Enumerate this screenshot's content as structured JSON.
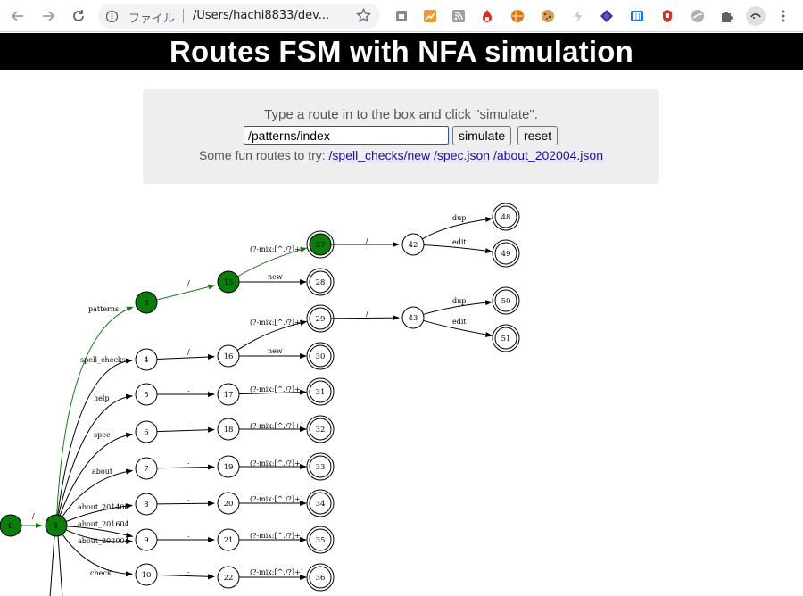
{
  "browser": {
    "omnibox_label": "ファイル",
    "url": "/Users/hachi8833/dev..."
  },
  "page": {
    "title": "Routes FSM with NFA simulation",
    "instructions": "Type a route in to the box and click \"simulate\".",
    "route_input_value": "/patterns/index",
    "simulate_label": "simulate",
    "reset_label": "reset",
    "fun_label": "Some fun routes to try:",
    "fun_routes": [
      "/spell_checks/new",
      "/spec.json",
      "/about_202004.json"
    ]
  },
  "colors": {
    "active_node": "#0a7d0a",
    "active_edge": "#1a7a1a",
    "banner": "#000000",
    "link": "#1a0dab"
  },
  "graph": {
    "nodes": [
      {
        "id": "0",
        "final": false,
        "active": true
      },
      {
        "id": "1",
        "final": false,
        "active": true
      },
      {
        "id": "3",
        "final": false,
        "active": true
      },
      {
        "id": "15",
        "final": false,
        "active": true
      },
      {
        "id": "27",
        "final": true,
        "active": true
      },
      {
        "id": "28",
        "final": true,
        "active": false
      },
      {
        "id": "42",
        "final": false,
        "active": false
      },
      {
        "id": "48",
        "final": true,
        "active": false
      },
      {
        "id": "49",
        "final": true,
        "active": false
      },
      {
        "id": "4",
        "final": false,
        "active": false
      },
      {
        "id": "16",
        "final": false,
        "active": false
      },
      {
        "id": "29",
        "final": true,
        "active": false
      },
      {
        "id": "30",
        "final": true,
        "active": false
      },
      {
        "id": "43",
        "final": false,
        "active": false
      },
      {
        "id": "50",
        "final": true,
        "active": false
      },
      {
        "id": "51",
        "final": true,
        "active": false
      },
      {
        "id": "5",
        "final": false,
        "active": false
      },
      {
        "id": "17",
        "final": false,
        "active": false
      },
      {
        "id": "31",
        "final": true,
        "active": false
      },
      {
        "id": "6",
        "final": false,
        "active": false
      },
      {
        "id": "18",
        "final": false,
        "active": false
      },
      {
        "id": "32",
        "final": true,
        "active": false
      },
      {
        "id": "7",
        "final": false,
        "active": false
      },
      {
        "id": "19",
        "final": false,
        "active": false
      },
      {
        "id": "33",
        "final": true,
        "active": false
      },
      {
        "id": "8",
        "final": false,
        "active": false
      },
      {
        "id": "20",
        "final": false,
        "active": false
      },
      {
        "id": "34",
        "final": true,
        "active": false
      },
      {
        "id": "9",
        "final": false,
        "active": false
      },
      {
        "id": "21",
        "final": false,
        "active": false
      },
      {
        "id": "35",
        "final": true,
        "active": false
      },
      {
        "id": "10",
        "final": false,
        "active": false
      },
      {
        "id": "22",
        "final": false,
        "active": false
      },
      {
        "id": "36",
        "final": true,
        "active": false
      }
    ],
    "edges": [
      {
        "from": "0",
        "to": "1",
        "label": "/",
        "active": true
      },
      {
        "from": "1",
        "to": "3",
        "label": "patterns",
        "active": true
      },
      {
        "from": "3",
        "to": "15",
        "label": "/",
        "active": true
      },
      {
        "from": "15",
        "to": "27",
        "label": "(?-mix:[^./?]+)",
        "active": true
      },
      {
        "from": "15",
        "to": "28",
        "label": "new",
        "active": false
      },
      {
        "from": "27",
        "to": "42",
        "label": "/",
        "active": false
      },
      {
        "from": "42",
        "to": "48",
        "label": "dup",
        "active": false
      },
      {
        "from": "42",
        "to": "49",
        "label": "edit",
        "active": false
      },
      {
        "from": "1",
        "to": "4",
        "label": "spell_checks",
        "active": false
      },
      {
        "from": "4",
        "to": "16",
        "label": "/",
        "active": false
      },
      {
        "from": "16",
        "to": "29",
        "label": "(?-mix:[^./?]+)",
        "active": false
      },
      {
        "from": "16",
        "to": "30",
        "label": "new",
        "active": false
      },
      {
        "from": "29",
        "to": "43",
        "label": "/",
        "active": false
      },
      {
        "from": "43",
        "to": "50",
        "label": "dup",
        "active": false
      },
      {
        "from": "43",
        "to": "51",
        "label": "edit",
        "active": false
      },
      {
        "from": "1",
        "to": "5",
        "label": "help",
        "active": false
      },
      {
        "from": "5",
        "to": "17",
        "label": ".",
        "active": false
      },
      {
        "from": "17",
        "to": "31",
        "label": "(?-mix:[^./?]+)",
        "active": false
      },
      {
        "from": "1",
        "to": "6",
        "label": "spec",
        "active": false
      },
      {
        "from": "6",
        "to": "18",
        "label": ".",
        "active": false
      },
      {
        "from": "18",
        "to": "32",
        "label": "(?-mix:[^./?]+)",
        "active": false
      },
      {
        "from": "1",
        "to": "7",
        "label": "about",
        "active": false
      },
      {
        "from": "7",
        "to": "19",
        "label": ".",
        "active": false
      },
      {
        "from": "19",
        "to": "33",
        "label": "(?-mix:[^./?]+)",
        "active": false
      },
      {
        "from": "1",
        "to": "8",
        "label": "about_201408",
        "active": false
      },
      {
        "from": "8",
        "to": "20",
        "label": ".",
        "active": false
      },
      {
        "from": "20",
        "to": "34",
        "label": "(?-mix:[^./?]+)",
        "active": false
      },
      {
        "from": "1",
        "to": "9",
        "label": "about_201604",
        "active": false
      },
      {
        "from": "1",
        "to": "9",
        "label": "about_202004",
        "active": false
      },
      {
        "from": "9",
        "to": "21",
        "label": ".",
        "active": false
      },
      {
        "from": "21",
        "to": "35",
        "label": "(?-mix:[^./?]+)",
        "active": false
      },
      {
        "from": "1",
        "to": "10",
        "label": "check",
        "active": false
      },
      {
        "from": "10",
        "to": "22",
        "label": ".",
        "active": false
      },
      {
        "from": "22",
        "to": "36",
        "label": "(?-mix:[^./?]+)",
        "active": false
      }
    ]
  }
}
